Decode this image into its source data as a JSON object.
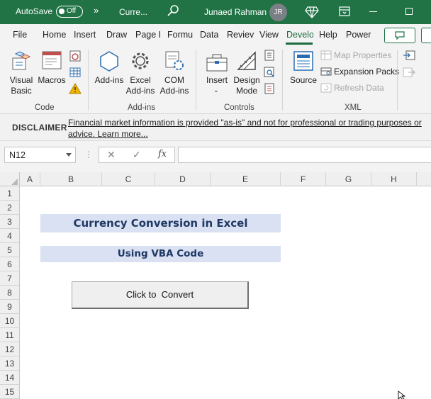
{
  "titlebar": {
    "autosave_label": "AutoSave",
    "autosave_state": "Off",
    "more_glyph": "»",
    "file_name": "Curre...",
    "user_name": "Junaed Rahman",
    "user_initials": "JR",
    "accent_color": "#217346"
  },
  "tabs": [
    {
      "label": "File"
    },
    {
      "label": "Home"
    },
    {
      "label": "Insert"
    },
    {
      "label": "Draw"
    },
    {
      "label": "Page I"
    },
    {
      "label": "Formu"
    },
    {
      "label": "Data"
    },
    {
      "label": "Reviev"
    },
    {
      "label": "View"
    },
    {
      "label": "Develo"
    },
    {
      "label": "Help"
    },
    {
      "label": "Power"
    }
  ],
  "active_tab": "Develo",
  "ribbon": {
    "code": {
      "visual_basic": "Visual Basic",
      "macros": "Macros",
      "group": "Code"
    },
    "addins": {
      "addins": "Add-ins",
      "excel_addins": "Excel Add-ins",
      "com_addins": "COM Add-ins",
      "group": "Add-ins"
    },
    "controls": {
      "insert": "Insert",
      "design_mode": "Design Mode",
      "group": "Controls"
    },
    "xml": {
      "source": "Source",
      "map_properties": "Map Properties",
      "expansion_packs": "Expansion Packs",
      "refresh_data": "Refresh Data",
      "group": "XML"
    }
  },
  "message_bar": {
    "title": "DISCLAIMER",
    "text": "Financial market information is provided \"as-is\" and not for professional or trading purposes or advice. Learn more..."
  },
  "formula_bar": {
    "name_box": "N12",
    "cancel_glyph": "✕",
    "enter_glyph": "✓",
    "fx_label": "fx",
    "formula": ""
  },
  "grid": {
    "columns": [
      "A",
      "B",
      "C",
      "D",
      "E",
      "F",
      "G",
      "H"
    ],
    "rows": [
      "1",
      "2",
      "3",
      "4",
      "5",
      "6",
      "7",
      "8",
      "9",
      "10",
      "11",
      "12",
      "13",
      "14",
      "15"
    ]
  },
  "sheet": {
    "title": "Currency Conversion in Excel",
    "subtitle": "Using VBA Code",
    "button_label": "Click to  Convert",
    "banner_color": "#d9e1f2"
  }
}
